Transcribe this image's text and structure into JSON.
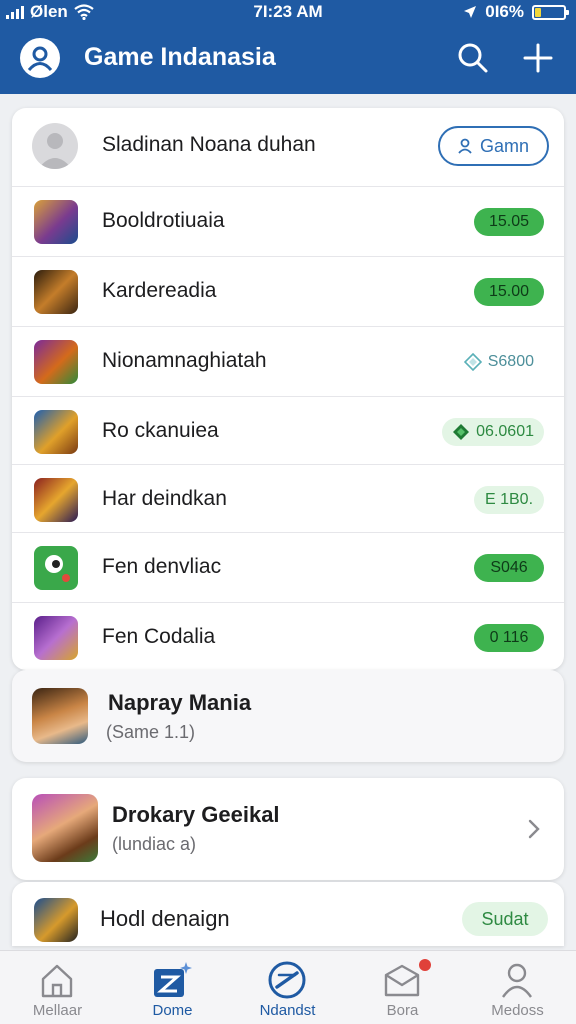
{
  "status_bar": {
    "carrier": "Ølen",
    "time": "7I:23 AM",
    "battery": "0I6%",
    "battery_level": 0.2
  },
  "header": {
    "title": "Game Indanasia",
    "logo": "avatar-logo-icon",
    "search_icon": "search-icon",
    "add_icon": "plus-icon",
    "color": "#1f5aa3"
  },
  "profile": {
    "name": "Sladinan Noana duhan",
    "button_label": "Gamn",
    "button_icon": "person-icon"
  },
  "games": [
    {
      "name": "Booldrotiuaia",
      "value": "15.05",
      "style": "solid",
      "icon": "game-thumbnail-icon"
    },
    {
      "name": "Kardereadia",
      "value": "15.00",
      "style": "solid",
      "icon": "game-thumbnail-icon"
    },
    {
      "name": "Nionamnaghiatah",
      "value": "S6800",
      "style": "text",
      "prefix_icon": "diamond-outline-icon",
      "icon": "game-thumbnail-icon"
    },
    {
      "name": "Ro ckanuiea",
      "value": "06.0601",
      "style": "light",
      "prefix_icon": "diamond-filled-icon",
      "icon": "game-thumbnail-icon"
    },
    {
      "name": "Har deindkan",
      "value": "E 1B0.",
      "style": "light",
      "icon": "game-thumbnail-icon"
    },
    {
      "name": "Fen denvliac",
      "value": "S046",
      "style": "solid",
      "icon": "game-thumbnail-icon"
    },
    {
      "name": "Fen Codalia",
      "value": "0 116",
      "style": "solid",
      "icon": "game-thumbnail-icon"
    }
  ],
  "featured": {
    "title": "Napray Mania",
    "subtitle": "(Same  1.1)"
  },
  "secondary": {
    "title": "Drokary Geeikal",
    "subtitle": "(lundiac a)",
    "chevron": "chevron-right-icon"
  },
  "third": {
    "title": "Hodl denaign",
    "button_label": "Sudat"
  },
  "bottom_nav": [
    {
      "label": "Mellaar",
      "icon": "home-icon",
      "active": false
    },
    {
      "label": "Dome",
      "icon": "sparkle-z-icon",
      "active": true
    },
    {
      "label": "Ndandst",
      "icon": "compass-icon",
      "active": true
    },
    {
      "label": "Bora",
      "icon": "inbox-icon",
      "active": false,
      "badge": true
    },
    {
      "label": "Medoss",
      "icon": "profile-icon",
      "active": false
    }
  ],
  "colors": {
    "accent": "#1f5aa3",
    "green": "#3eb34f",
    "light_green": "#e3f5e5",
    "badge": "#e0413a"
  }
}
